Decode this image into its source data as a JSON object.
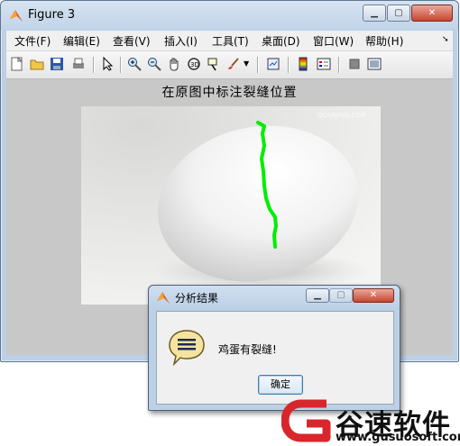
{
  "figure": {
    "title": "Figure 3",
    "menu": [
      "文件(F)",
      "编辑(E)",
      "查看(V)",
      "插入(I)",
      "工具(T)",
      "桌面(D)",
      "窗口(W)",
      "帮助(H)"
    ],
    "toolbar_icons": [
      "new-file-icon",
      "open-folder-icon",
      "save-icon",
      "print-icon",
      "arrow-pointer-icon",
      "zoom-in-icon",
      "zoom-out-icon",
      "pan-hand-icon",
      "rotate-3d-icon",
      "data-cursor-icon",
      "brush-icon",
      "link-plot-icon",
      "colorbar-icon",
      "legend-icon",
      "hide-plot-tools-icon",
      "show-plot-tools-icon"
    ],
    "plot_title": "在原图中标注裂缝位置",
    "image_watermark": "QUANJING.COM",
    "crack_color": "#00ee00"
  },
  "dialog": {
    "title": "分析结果",
    "message": "鸡蛋有裂缝!",
    "ok_label": "确定"
  },
  "watermark": {
    "brand": "谷速软件",
    "url": "www.gusuosoft.com",
    "accent": "#d8262c"
  }
}
